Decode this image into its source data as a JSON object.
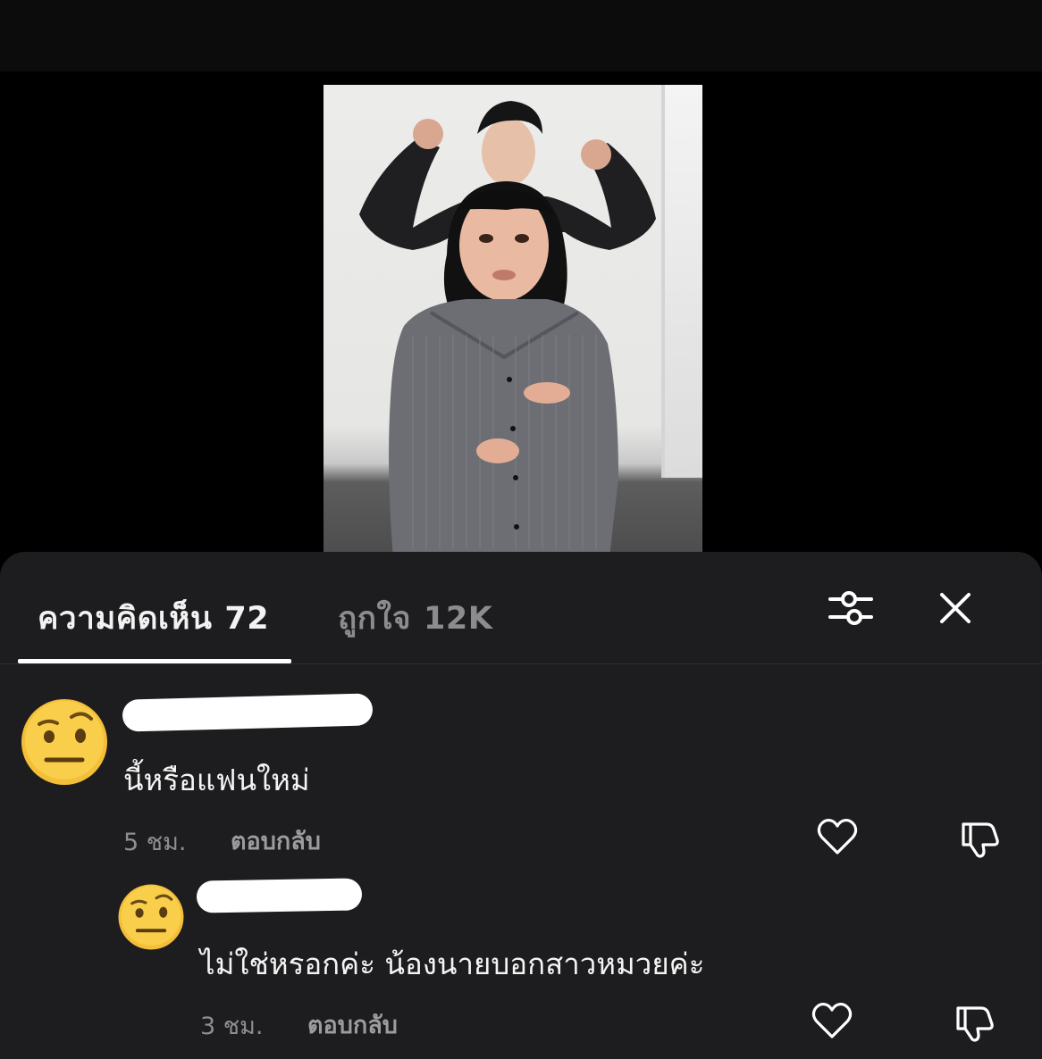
{
  "video": {
    "alt_icon": "video-preview-image"
  },
  "tabs": {
    "comments_label": "ความคิดเห็น",
    "comments_count": "72",
    "likes_label": "ถูกใจ",
    "likes_count": "12K"
  },
  "toolbar": {
    "filter_icon": "sliders-icon",
    "close_icon": "close-icon"
  },
  "comments": [
    {
      "avatar_icon": "raised-eyebrow-emoji",
      "text": "นี้หรือแฟนใหม่",
      "time": "5 ชม.",
      "reply_label": "ตอบกลับ"
    },
    {
      "avatar_icon": "raised-eyebrow-emoji",
      "text": "ไม่ใช่หรอกค่ะ น้องนายบอกสาวหมวยค่ะ",
      "time": "3 ชม.",
      "reply_label": "ตอบกลับ"
    }
  ],
  "colors": {
    "sheet_bg": "#1d1d1f",
    "active_tab": "#f2f2f2",
    "inactive_tab": "#8c8c8e",
    "meta_text": "#8e8e90"
  }
}
